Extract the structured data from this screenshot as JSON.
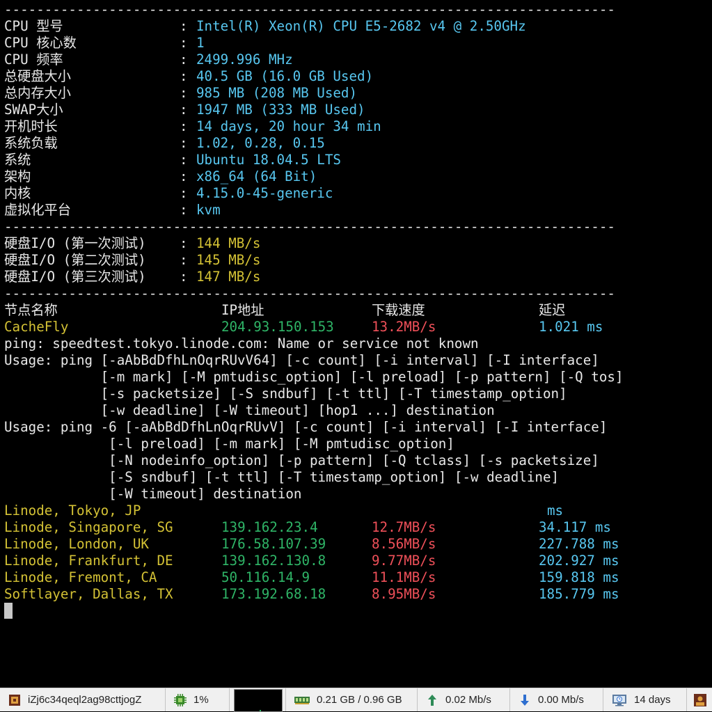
{
  "separator": "----------------------------------------------------------------------------",
  "sysinfo": [
    {
      "label": "CPU 型号",
      "value": "Intel(R) Xeon(R) CPU E5-2682 v4 @ 2.50GHz"
    },
    {
      "label": "CPU 核心数",
      "value": "1"
    },
    {
      "label": "CPU 频率",
      "value": "2499.996 MHz"
    },
    {
      "label": "总硬盘大小",
      "value": "40.5 GB (16.0 GB Used)"
    },
    {
      "label": "总内存大小",
      "value": "985 MB (208 MB Used)"
    },
    {
      "label": "SWAP大小",
      "value": "1947 MB (333 MB Used)"
    },
    {
      "label": "开机时长",
      "value": "14 days, 20 hour 34 min"
    },
    {
      "label": "系统负载",
      "value": "1.02, 0.28, 0.15"
    },
    {
      "label": "系统",
      "value": "Ubuntu 18.04.5 LTS"
    },
    {
      "label": "架构",
      "value": "x86_64 (64 Bit)"
    },
    {
      "label": "内核",
      "value": "4.15.0-45-generic"
    },
    {
      "label": "虚拟化平台",
      "value": "kvm"
    }
  ],
  "colon": ":",
  "io": [
    {
      "label": "硬盘I/O (第一次测试)",
      "value": "144 MB/s"
    },
    {
      "label": "硬盘I/O (第二次测试)",
      "value": "145 MB/s"
    },
    {
      "label": "硬盘I/O (第三次测试)",
      "value": "147 MB/s"
    }
  ],
  "speed_header": {
    "node": "节点名称",
    "ip": "IP地址",
    "speed": "下载速度",
    "latency": "延迟"
  },
  "cachefly": {
    "node": "CacheFly",
    "ip": "204.93.150.153",
    "speed": "13.2MB/s",
    "latency": "1.021 ms"
  },
  "ping_output": [
    "ping: speedtest.tokyo.linode.com: Name or service not known",
    "Usage: ping [-aAbBdDfhLnOqrRUvV64] [-c count] [-i interval] [-I interface]",
    "            [-m mark] [-M pmtudisc_option] [-l preload] [-p pattern] [-Q tos]",
    "            [-s packetsize] [-S sndbuf] [-t ttl] [-T timestamp_option]",
    "            [-w deadline] [-W timeout] [hop1 ...] destination",
    "Usage: ping -6 [-aAbBdDfhLnOqrRUvV] [-c count] [-i interval] [-I interface]",
    "             [-l preload] [-m mark] [-M pmtudisc_option]",
    "             [-N nodeinfo_option] [-p pattern] [-Q tclass] [-s packetsize]",
    "             [-S sndbuf] [-t ttl] [-T timestamp_option] [-w deadline]",
    "             [-W timeout] destination"
  ],
  "tokyo": {
    "node": "Linode, Tokyo, JP",
    "latency": "ms"
  },
  "speed_rows": [
    {
      "node": "Linode, Singapore, SG",
      "ip": "139.162.23.4",
      "speed": "12.7MB/s",
      "latency": "34.117 ms"
    },
    {
      "node": "Linode, London, UK",
      "ip": "176.58.107.39",
      "speed": "8.56MB/s",
      "latency": "227.788 ms"
    },
    {
      "node": "Linode, Frankfurt, DE",
      "ip": "139.162.130.8",
      "speed": "9.77MB/s",
      "latency": "202.927 ms"
    },
    {
      "node": "Linode, Fremont, CA",
      "ip": "50.116.14.9",
      "speed": "11.1MB/s",
      "latency": "159.818 ms"
    },
    {
      "node": "Softlayer, Dallas, TX",
      "ip": "173.192.68.18",
      "speed": "8.95MB/s",
      "latency": "185.779 ms"
    }
  ],
  "taskbar": {
    "host": "iZj6c34qeql2ag98cttjogZ",
    "cpu": "1%",
    "memory": "0.21 GB / 0.96 GB",
    "upload": "0.02 Mb/s",
    "download": "0.00 Mb/s",
    "uptime": "14 days"
  },
  "colors": {
    "cyan": "#58c7f0",
    "yellow": "#d4c235",
    "green": "#2fb567",
    "red": "#ef5059"
  }
}
